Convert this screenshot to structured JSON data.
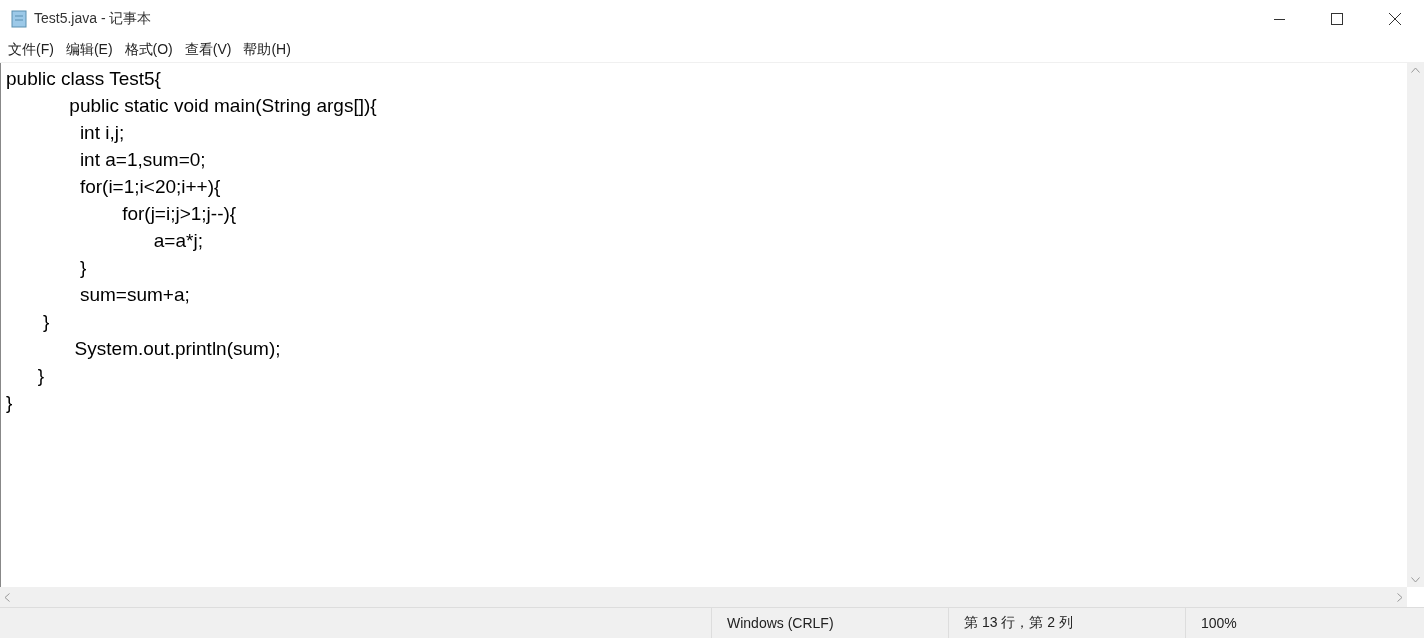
{
  "window": {
    "title": "Test5.java - 记事本"
  },
  "menu": [
    "文件(F)",
    "编辑(E)",
    "格式(O)",
    "查看(V)",
    "帮助(H)"
  ],
  "editor": {
    "lines": [
      "public class Test5{",
      "            public static void main(String args[]){",
      "              int i,j;",
      "              int a=1,sum=0;",
      "              for(i=1;i<20;i++){",
      "                      for(j=i;j>1;j--){",
      "                            a=a*j;",
      "              }",
      "              sum=sum+a;",
      "       }",
      "             System.out.println(sum);",
      "      }",
      "}"
    ]
  },
  "status_bar": [
    "Windows (CRLF)",
    "第 13 行，第 2 列",
    "100%"
  ]
}
